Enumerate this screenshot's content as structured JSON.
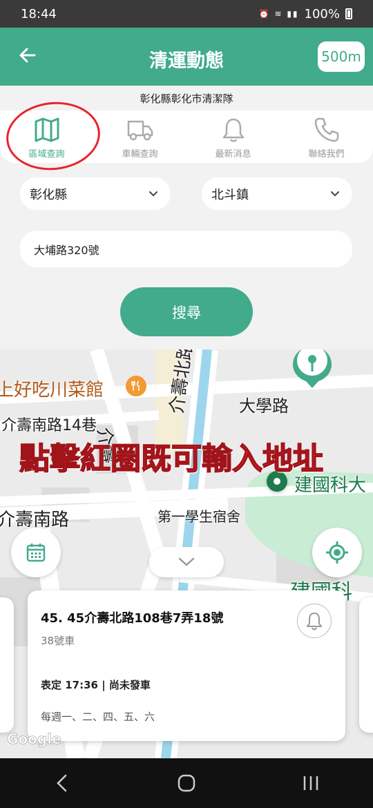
{
  "status": {
    "time": "18:44",
    "battery": "100%"
  },
  "header": {
    "title": "清運動態",
    "distance_label": "500m"
  },
  "department": "彰化縣彰化市清潔隊",
  "nav": [
    {
      "label": "區域查詢"
    },
    {
      "label": "車輛查詢"
    },
    {
      "label": "最新消息"
    },
    {
      "label": "聯絡我們"
    }
  ],
  "form": {
    "county": "彰化縣",
    "town": "北斗鎮",
    "address": "大埔路320號",
    "search_label": "搜尋"
  },
  "map": {
    "labels": {
      "restaurant": "上好吃川菜館",
      "lane14": "介壽南路14巷",
      "daxue": "大學路",
      "road_diag": "介壽北路",
      "jianguo": "建國科大",
      "jieshou_s": "介壽南路",
      "dorm": "第一學生宿舍",
      "jianguo2": "建國科",
      "road_left": "介壽"
    },
    "annotation": "點擊紅圈既可輸入地址",
    "attribution": "Google"
  },
  "card": {
    "stop_name": "45. 45介壽北路108巷7弄18號",
    "car_no": "38號車",
    "schedule": "表定 17:36  |  尚未發車",
    "days": "每週一、二、四、五、六"
  },
  "colors": {
    "accent": "#41ab8c",
    "annotation": "#e8242b"
  }
}
